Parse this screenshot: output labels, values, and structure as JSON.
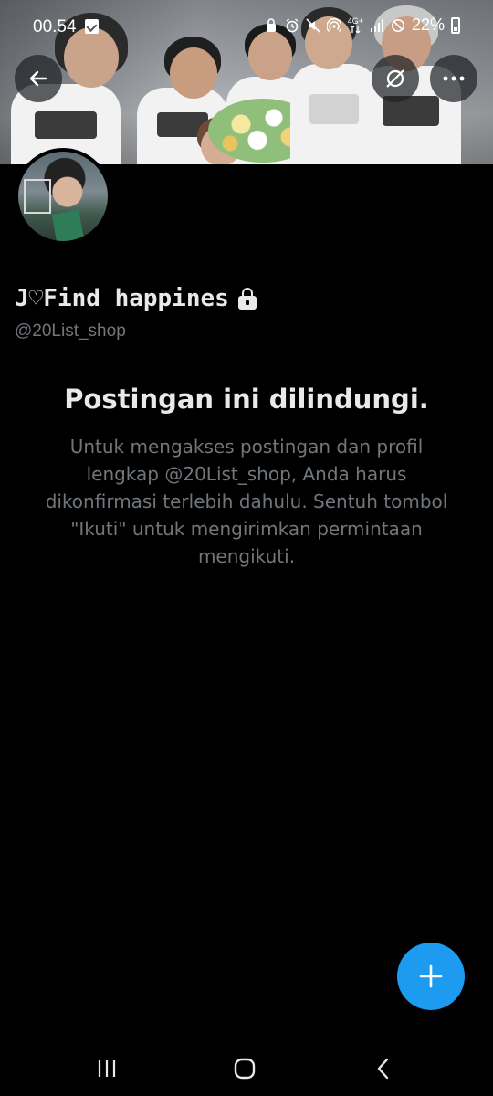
{
  "status_bar": {
    "time": "00.54",
    "network_label": "4G+",
    "battery_percent": "22%",
    "icons": [
      "checklist-notification-icon",
      "lock-screen-icon",
      "alarm-icon",
      "mute-icon",
      "hotspot-icon",
      "network-arrows-icon",
      "signal-icon",
      "do-not-disturb-icon",
      "battery-icon"
    ]
  },
  "header": {
    "back_icon": "arrow-left-icon",
    "refresh_icon": "refresh-disabled-icon",
    "more_icon": "more-horizontal-icon"
  },
  "profile": {
    "display_name": "J♡Find happines",
    "handle": "@20List_shop",
    "protected": true
  },
  "protected_notice": {
    "title": "Postingan ini dilindungi.",
    "body": "Untuk mengakses postingan dan profil lengkap @20List_shop, Anda harus dikonfirmasi terlebih dahulu. Sentuh tombol \"Ikuti\" untuk mengirimkan permintaan mengikuti."
  },
  "fab": {
    "icon": "plus-icon",
    "color": "#1d9bf0"
  },
  "nav_bar": {
    "icons": [
      "recent-apps-icon",
      "home-icon",
      "back-icon"
    ]
  },
  "colors": {
    "background": "#000000",
    "primary_text": "#e7e9ea",
    "secondary_text": "#71767b",
    "accent": "#1d9bf0"
  }
}
